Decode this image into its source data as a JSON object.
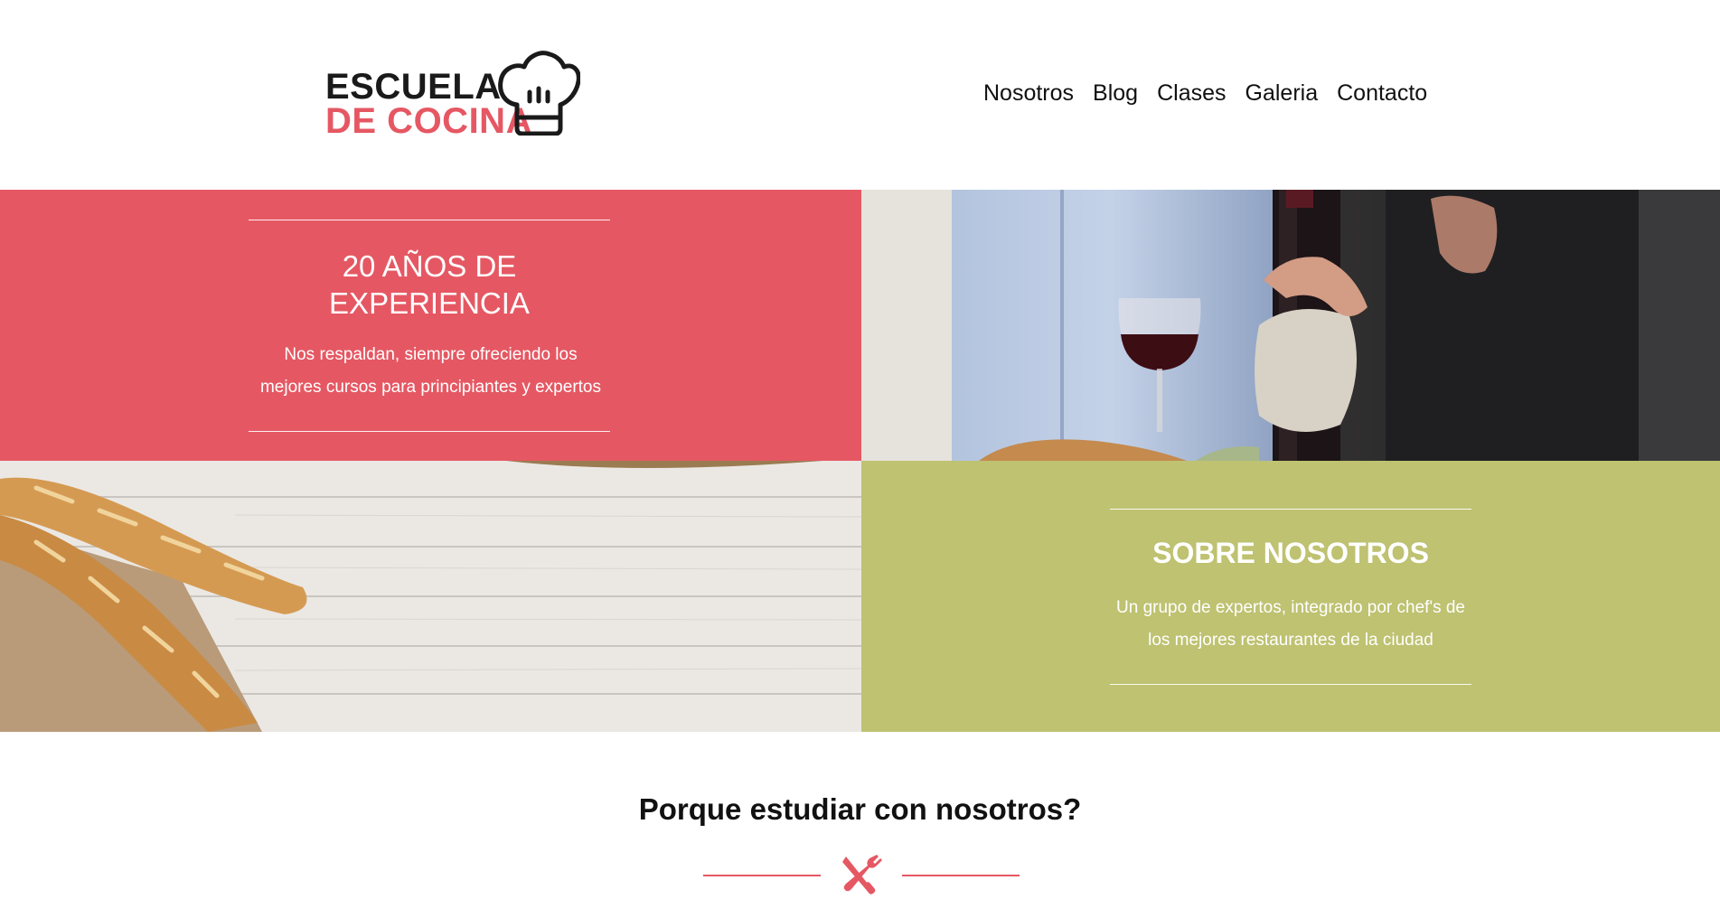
{
  "header": {
    "logo": {
      "line1": "ESCUELA",
      "line2": "DE COCINA",
      "icon": "chef-hat-icon"
    },
    "nav": [
      {
        "label": "Nosotros"
      },
      {
        "label": "Blog"
      },
      {
        "label": "Clases"
      },
      {
        "label": "Galeria"
      },
      {
        "label": "Contacto"
      }
    ]
  },
  "features": {
    "experience": {
      "title_line1": "20 AÑOS DE",
      "title_line2": "EXPERIENCIA",
      "text_line1": "Nos respaldan, siempre ofreciendo los",
      "text_line2": "mejores cursos para principiantes y expertos"
    },
    "about": {
      "title": "SOBRE NOSOTROS",
      "text_line1": "Un grupo de expertos, integrado por chef's de",
      "text_line2": "los mejores restaurantes de la ciudad"
    },
    "images": {
      "wine": "wine-tasting-photo",
      "bread": "baguettes-on-wood-photo"
    }
  },
  "why": {
    "title": "Porque estudiar con nosotros?",
    "icon": "fork-knife-icon"
  },
  "colors": {
    "brand_red": "#e55863",
    "brand_green": "#bec271",
    "text_dark": "#111111"
  }
}
